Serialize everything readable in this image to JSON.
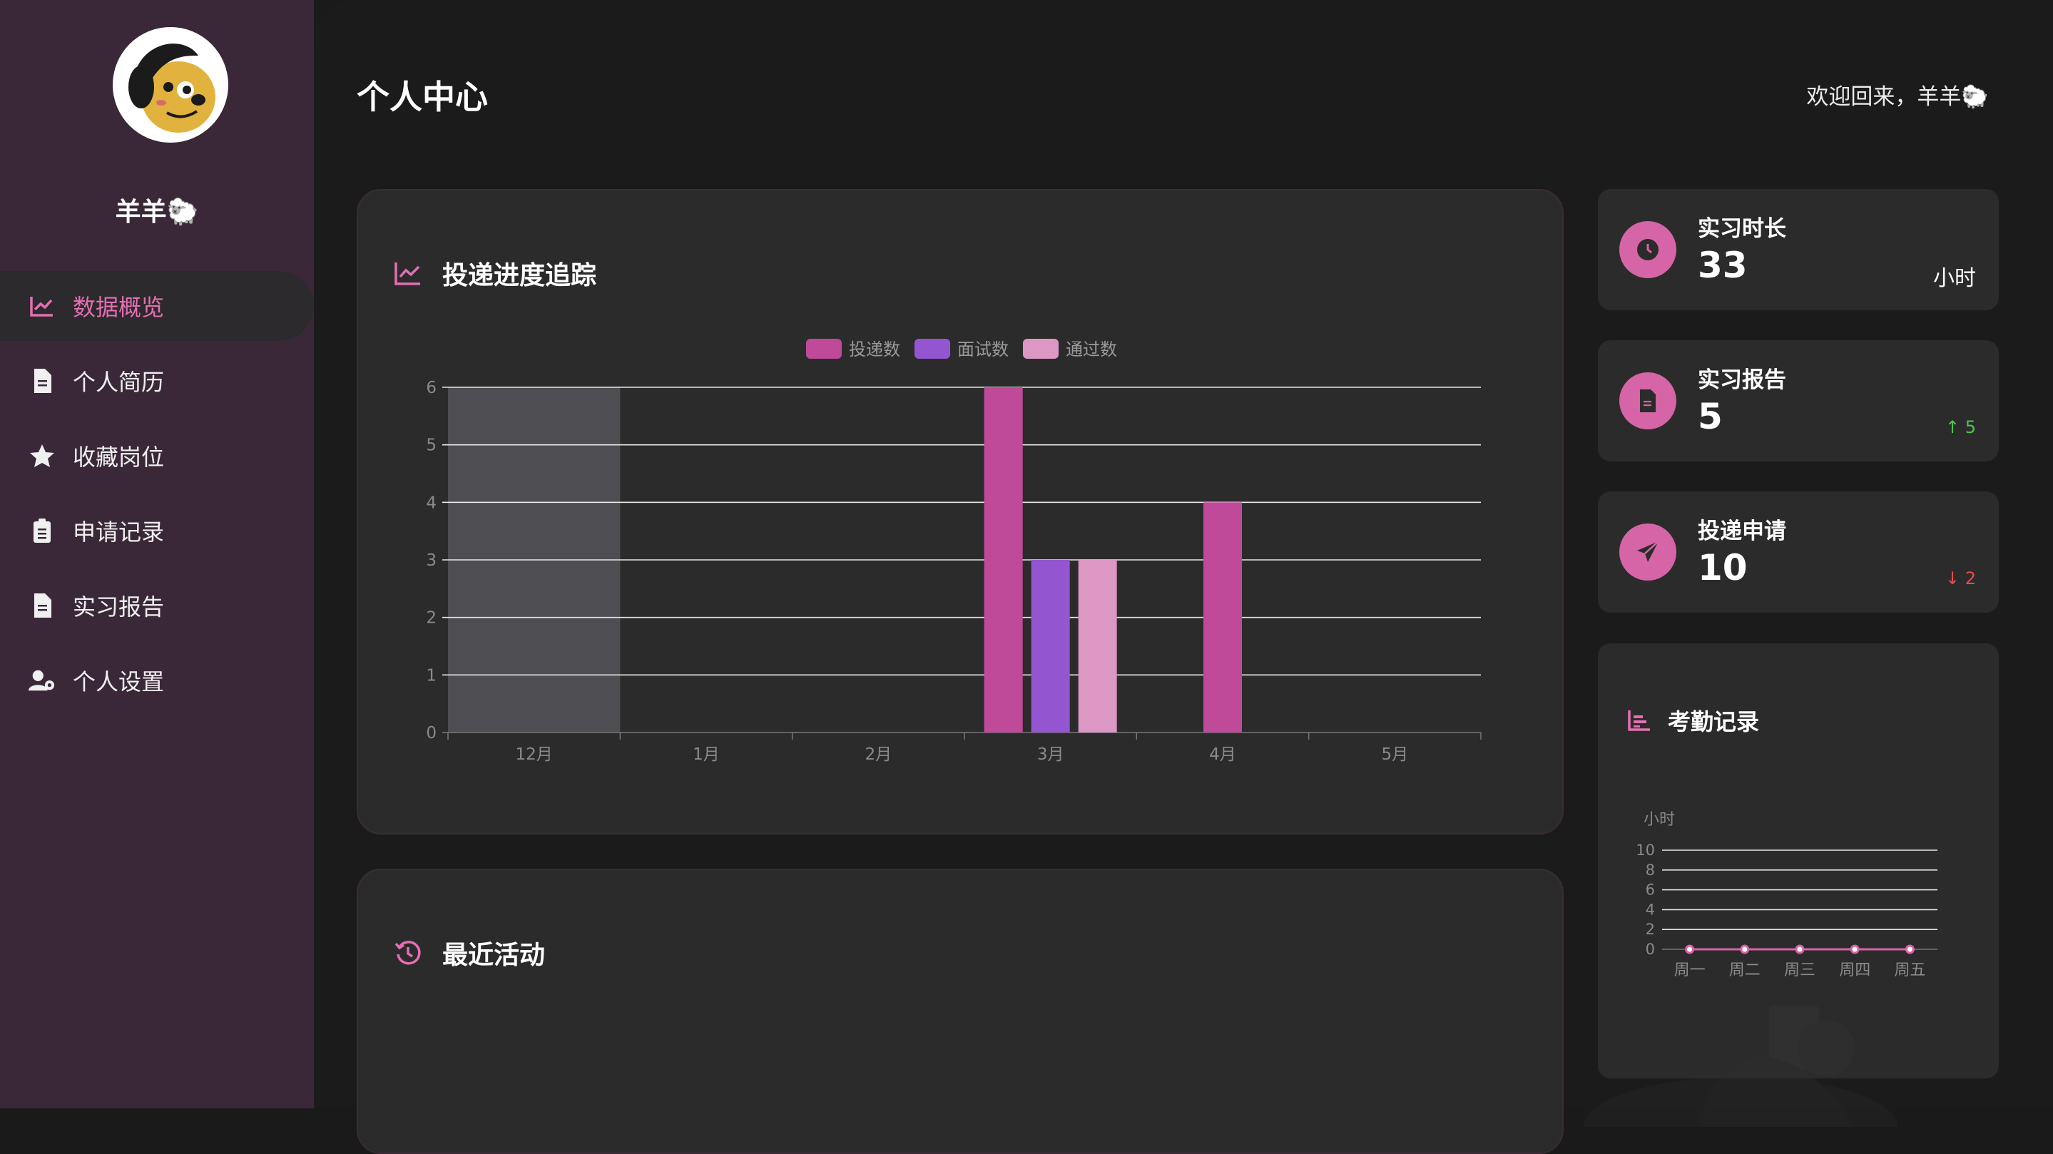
{
  "sidebar": {
    "username": "羊羊🐑",
    "items": [
      {
        "label": "数据概览",
        "icon": "chart-line-icon",
        "active": true
      },
      {
        "label": "个人简历",
        "icon": "file-icon"
      },
      {
        "label": "收藏岗位",
        "icon": "star-icon"
      },
      {
        "label": "申请记录",
        "icon": "clipboard-icon"
      },
      {
        "label": "实习报告",
        "icon": "file-icon"
      },
      {
        "label": "个人设置",
        "icon": "user-gear-icon"
      }
    ]
  },
  "header": {
    "title": "个人中心",
    "welcome": "欢迎回来，羊羊🐑"
  },
  "progress_card": {
    "title": "投递进度追踪"
  },
  "recent_card": {
    "title": "最近活动"
  },
  "stats": [
    {
      "label": "实习时长",
      "value": "33",
      "unit": "小时",
      "icon": "clock-icon"
    },
    {
      "label": "实习报告",
      "value": "5",
      "trend": "↑ 5",
      "trend_dir": "up",
      "icon": "file-icon"
    },
    {
      "label": "投递申请",
      "value": "10",
      "trend": "↓ 2",
      "trend_dir": "down",
      "icon": "paper-plane-icon"
    }
  ],
  "attendance_card": {
    "title": "考勤记录"
  },
  "colors": {
    "accent": "#d565a6",
    "sidebar_bg": "#3a2838",
    "card_bg": "#2c2b2c",
    "series_applied": "#c04a9a",
    "series_interview": "#9456d0",
    "series_passed": "#dc97c4"
  },
  "chart_data": [
    {
      "type": "bar",
      "categories": [
        "12月",
        "1月",
        "2月",
        "3月",
        "4月",
        "5月"
      ],
      "series": [
        {
          "name": "投递数",
          "values": [
            0,
            0,
            0,
            6,
            4,
            0
          ]
        },
        {
          "name": "面试数",
          "values": [
            0,
            0,
            0,
            3,
            0,
            0
          ]
        },
        {
          "name": "通过数",
          "values": [
            0,
            0,
            0,
            3,
            0,
            0
          ]
        }
      ],
      "ylim": [
        0,
        6
      ],
      "yticks": [
        0,
        1,
        2,
        3,
        4,
        5,
        6
      ],
      "grid": true,
      "legend": "top-center",
      "highlighted_category": "12月"
    },
    {
      "type": "line",
      "categories": [
        "周一",
        "周二",
        "周三",
        "周四",
        "周五"
      ],
      "series": [
        {
          "values": [
            0,
            0,
            0,
            0,
            0
          ]
        }
      ],
      "ylabel": "小时",
      "ylim": [
        0,
        10
      ],
      "yticks": [
        0,
        2,
        4,
        6,
        8,
        10
      ],
      "grid": true
    }
  ]
}
